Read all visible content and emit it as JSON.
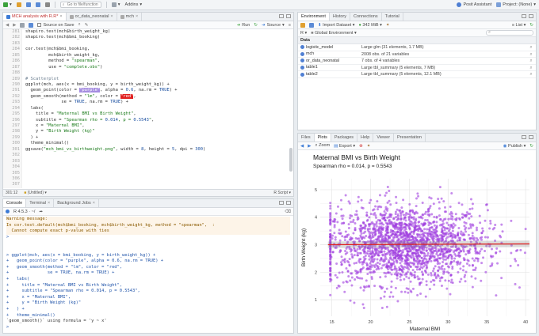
{
  "toolbar": {
    "goto_placeholder": "Go to file/function",
    "addins": "Addins",
    "assistant": "Posit Assistant",
    "project": "Project: (None)"
  },
  "editor": {
    "tabs": [
      {
        "label": "MCH analysis with R.R*",
        "active": true
      },
      {
        "label": "or_data_neonatal",
        "active": false
      },
      {
        "label": "mch",
        "active": false
      }
    ],
    "source_on_save": "Source on Save",
    "run": "Run",
    "source": "Source",
    "status_pos": "301:12",
    "status_scope": "(Untitled)",
    "status_type": "R Script",
    "lines": [
      {
        "n": "281",
        "t": "shapiro.test(mch$birth_weight_kg)"
      },
      {
        "n": "282",
        "t": "shapiro.test(mch$bmi_booking)"
      },
      {
        "n": "283",
        "t": ""
      },
      {
        "n": "284",
        "t": "cor.test(mch$bmi_booking,"
      },
      {
        "n": "285",
        "t": "         mch$birth_weight_kg,"
      },
      {
        "n": "286",
        "t": "         method = \"spearman\","
      },
      {
        "n": "287",
        "t": "         use = \"complete.obs\")"
      },
      {
        "n": "288",
        "t": ""
      },
      {
        "n": "289",
        "t": "# Scatterplot"
      },
      {
        "n": "290",
        "t": "ggplot(mch, aes(x = bmi_booking, y = birth_weight_kg)) +"
      },
      {
        "n": "291",
        "t": "  geom_point(color = \"purple\", alpha = 0.6, na.rm = TRUE) +"
      },
      {
        "n": "292",
        "t": "  geom_smooth(method = \"lm\", color = \"red\","
      },
      {
        "n": "293",
        "t": "              se = TRUE, na.rm = TRUE) +"
      },
      {
        "n": "294",
        "t": "  labs("
      },
      {
        "n": "295",
        "t": "    title = \"Maternal BMI vs Birth Weight\","
      },
      {
        "n": "296",
        "t": "    subtitle = \"Spearman rho = 0.014, p = 0.5543\","
      },
      {
        "n": "297",
        "t": "    x = \"Maternal BMI\","
      },
      {
        "n": "298",
        "t": "    y = \"Birth Weight (kg)\""
      },
      {
        "n": "299",
        "t": "  ) +"
      },
      {
        "n": "300",
        "t": "  theme_minimal()"
      },
      {
        "n": "301",
        "t": "ggsave(\"mch_bmi_vs_birthweight.png\", width = 8, height = 5, dpi = 300)"
      },
      {
        "n": "302",
        "t": ""
      },
      {
        "n": "303",
        "t": ""
      },
      {
        "n": "304",
        "t": ""
      },
      {
        "n": "305",
        "t": ""
      },
      {
        "n": "306",
        "t": ""
      },
      {
        "n": "307",
        "t": ""
      }
    ]
  },
  "console": {
    "tabs": [
      "Console",
      "Terminal",
      "Background Jobs"
    ],
    "path": "R 4.5.3 · ~/",
    "lines": [
      {
        "t": "Warning message:",
        "k": "warn"
      },
      {
        "t": "In cor.test.default(mch$bmi_booking, mch$birth_weight_kg, method = \"spearman\",  :",
        "k": "warn"
      },
      {
        "t": "  Cannot compute exact p-value with ties",
        "k": "warn"
      },
      {
        "t": ">",
        "k": "prompt"
      },
      {
        "t": "",
        "k": ""
      },
      {
        "t": "",
        "k": ""
      },
      {
        "t": "> ggplot(mch, aes(x = bmi_booking, y = birth_weight_kg)) +",
        "k": "prompt"
      },
      {
        "t": "+   geom_point(color = \"purple\", alpha = 0.6, na.rm = TRUE) +",
        "k": "prompt"
      },
      {
        "t": "+   geom_smooth(method = \"lm\", color = \"red\",",
        "k": "prompt"
      },
      {
        "t": "+               se = TRUE, na.rm = TRUE) +",
        "k": "prompt"
      },
      {
        "t": "+   labs(",
        "k": "prompt"
      },
      {
        "t": "+     title = \"Maternal BMI vs Birth Weight\",",
        "k": "prompt"
      },
      {
        "t": "+     subtitle = \"Spearman rho = 0.014, p = 0.5543\",",
        "k": "prompt"
      },
      {
        "t": "+     x = \"Maternal BMI\",",
        "k": "prompt"
      },
      {
        "t": "+     y = \"Birth Weight (kg)\"",
        "k": "prompt"
      },
      {
        "t": "+   ) +",
        "k": "prompt"
      },
      {
        "t": "+   theme_minimal()",
        "k": "prompt"
      },
      {
        "t": "`geom_smooth()` using formula = 'y ~ x'",
        "k": ""
      },
      {
        "t": ">",
        "k": "prompt"
      }
    ]
  },
  "environment": {
    "tabs": [
      "Environment",
      "History",
      "Connections",
      "Tutorial"
    ],
    "import": "Import Dataset",
    "memory": "342 MiB",
    "list": "List",
    "r_label": "R",
    "global": "Global Environment",
    "section": "Data",
    "rows": [
      {
        "name": "logistic_model",
        "value": "Large glm (31 elements, 1.7 MB)"
      },
      {
        "name": "mch",
        "value": "2008 obs. of 21 variables"
      },
      {
        "name": "or_data_neonatal",
        "value": "7 obs. of 4 variables"
      },
      {
        "name": "table1",
        "value": "Large tbl_summary (5 elements, 7 MB)"
      },
      {
        "name": "table2",
        "value": "Large tbl_summary (5 elements, 12.1 MB)"
      }
    ]
  },
  "files": {
    "tabs": [
      "Files",
      "Plots",
      "Packages",
      "Help",
      "Viewer",
      "Presentation"
    ],
    "zoom": "Zoom",
    "export": "Export",
    "publish": "Publish"
  },
  "chart_data": {
    "type": "scatter",
    "title": "Maternal BMI vs Birth Weight",
    "subtitle": "Spearman rho = 0.014, p = 0.5543",
    "xlabel": "Maternal BMI",
    "ylabel": "Birth Weight (kg)",
    "xlim": [
      13.5,
      40.5
    ],
    "ylim": [
      0.4,
      5.4
    ],
    "xticks": [
      15,
      20,
      25,
      30,
      35,
      40
    ],
    "yticks": [
      1,
      2,
      3,
      4,
      5
    ],
    "point_color": "#a040e0",
    "line_color": "#e02020",
    "regression": {
      "x": [
        14.5,
        40.5
      ],
      "y": [
        3.0,
        3.03
      ]
    },
    "n_points": 2008
  }
}
